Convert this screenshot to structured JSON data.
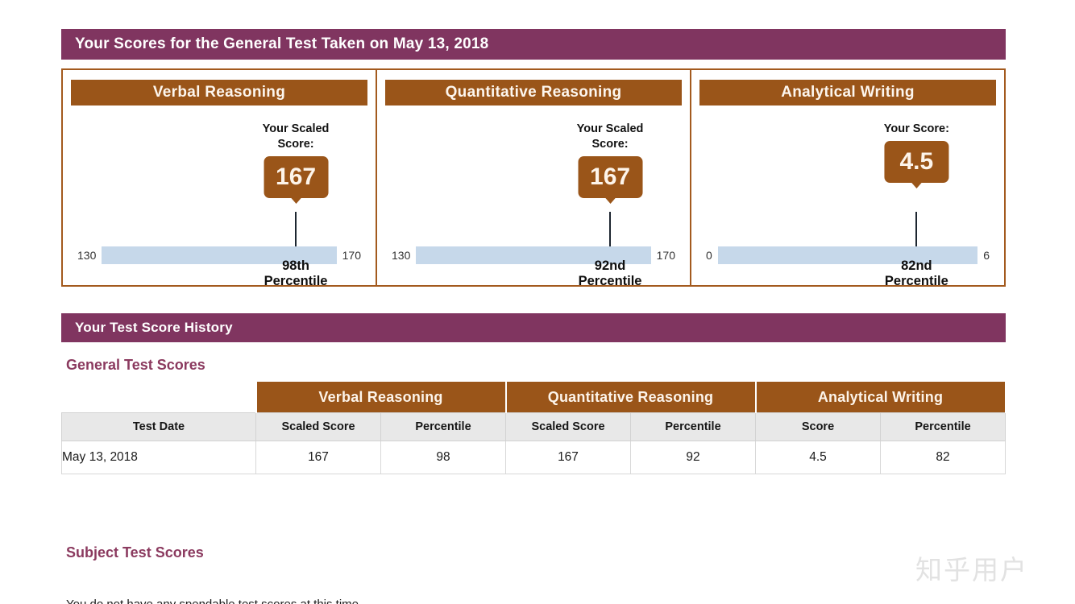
{
  "scores_banner": {
    "title": "Your Scores for the General Test Taken on May 13, 2018"
  },
  "score_cards": [
    {
      "title": "Verbal Reasoning",
      "score_label": "Your Scaled Score:",
      "score_value": "167",
      "scale_min": "130",
      "scale_max": "170",
      "percentile_line1": "98th",
      "percentile_line2": "Percentile"
    },
    {
      "title": "Quantitative Reasoning",
      "score_label": "Your Scaled Score:",
      "score_value": "167",
      "scale_min": "130",
      "scale_max": "170",
      "percentile_line1": "92nd",
      "percentile_line2": "Percentile"
    },
    {
      "title": "Analytical Writing",
      "score_label": "Your Score:",
      "score_value": "4.5",
      "scale_min": "0",
      "scale_max": "6",
      "percentile_line1": "82nd",
      "percentile_line2": "Percentile"
    }
  ],
  "history_banner": {
    "title": "Your Test Score History"
  },
  "general_test": {
    "heading": "General Test Scores",
    "group_headers": [
      "Verbal Reasoning",
      "Quantitative Reasoning",
      "Analytical Writing"
    ],
    "column_headers": [
      "Test Date",
      "Scaled Score",
      "Percentile",
      "Scaled Score",
      "Percentile",
      "Score",
      "Percentile"
    ],
    "rows": [
      [
        "May 13, 2018",
        "167",
        "98",
        "167",
        "92",
        "4.5",
        "82"
      ]
    ]
  },
  "subject_test": {
    "heading": "Subject Test Scores",
    "note": "You do not have any spendable test scores at this time."
  },
  "watermark": {
    "text": "知乎用户"
  },
  "chart_data": {
    "type": "bar",
    "title": "Your Scores for the General Test Taken on May 13, 2018",
    "series": [
      {
        "name": "Verbal Reasoning",
        "value": 167,
        "min": 130,
        "max": 170,
        "percentile": 98
      },
      {
        "name": "Quantitative Reasoning",
        "value": 167,
        "min": 130,
        "max": 170,
        "percentile": 92
      },
      {
        "name": "Analytical Writing",
        "value": 4.5,
        "min": 0,
        "max": 6,
        "percentile": 82
      }
    ]
  }
}
